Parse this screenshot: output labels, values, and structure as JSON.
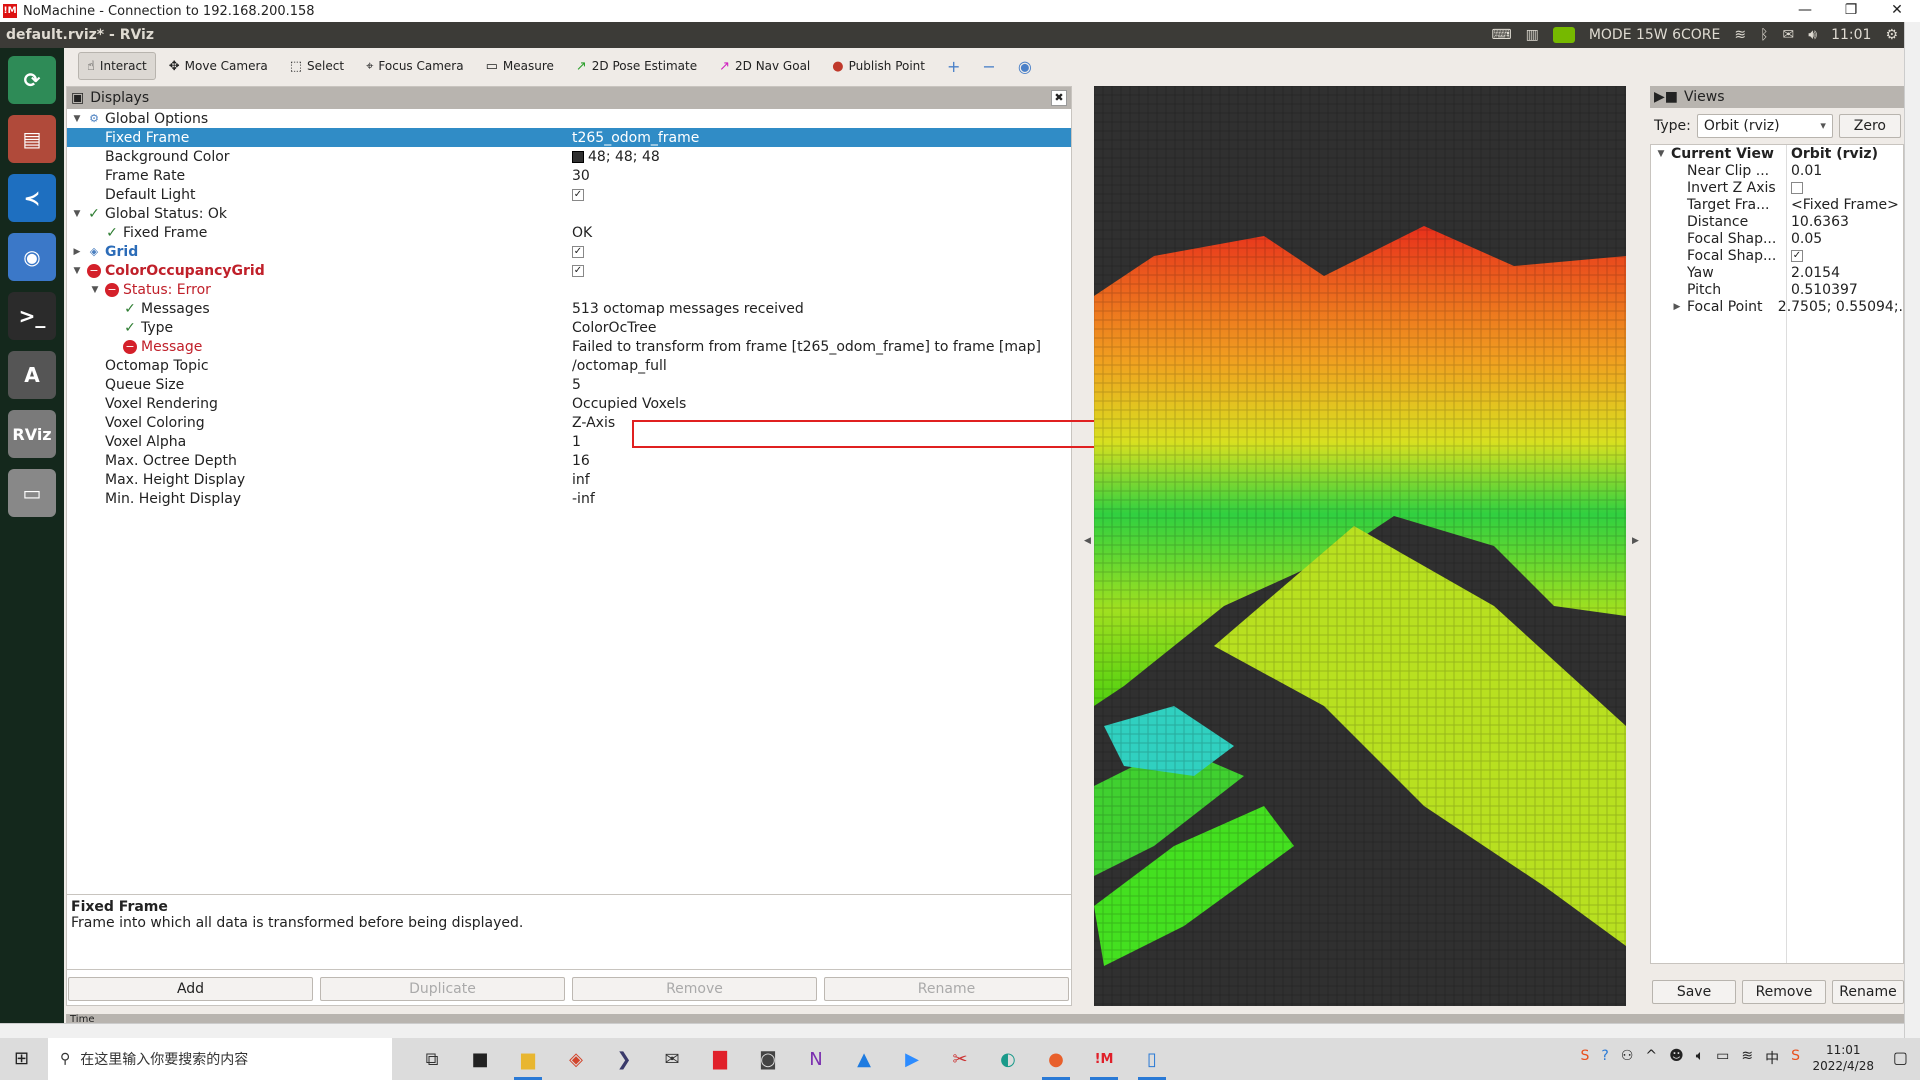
{
  "nomachine": {
    "title": "NoMachine - Connection to 192.168.200.158",
    "logo": "!M"
  },
  "window": {
    "title": "default.rviz* - RViz",
    "min": "—",
    "restore": "❐",
    "close": "✕"
  },
  "tray": {
    "power_mode": "MODE 15W 6CORE",
    "time": "11:01",
    "icons": [
      "keyboard-icon",
      "nomachine-icon",
      "nvidia-icon",
      "wifi-icon",
      "bluetooth-icon",
      "mail-icon",
      "volume-icon",
      "settings-icon"
    ]
  },
  "launcher": [
    {
      "name": "ros-launcher",
      "glyph": "⟳",
      "color": "#2e8b57"
    },
    {
      "name": "files",
      "glyph": "▤",
      "color": "#b04a3a"
    },
    {
      "name": "vscode",
      "glyph": "≺",
      "color": "#1e6fc0"
    },
    {
      "name": "chromium",
      "glyph": "◉",
      "color": "#3b78c8"
    },
    {
      "name": "terminal",
      "glyph": ">_",
      "color": "#2b2b2b"
    },
    {
      "name": "software-updater",
      "glyph": "A",
      "color": "#555"
    },
    {
      "name": "rviz",
      "glyph": "RViz",
      "color": "#7a7a7a"
    },
    {
      "name": "drive",
      "glyph": "▭",
      "color": "#888"
    }
  ],
  "toolbar": [
    {
      "label": "Interact",
      "icon": "hand-icon",
      "glyph": "☝",
      "active": true
    },
    {
      "label": "Move Camera",
      "icon": "move-camera-icon",
      "glyph": "✥"
    },
    {
      "label": "Select",
      "icon": "select-icon",
      "glyph": "⬚"
    },
    {
      "label": "Focus Camera",
      "icon": "focus-camera-icon",
      "glyph": "⌖"
    },
    {
      "label": "Measure",
      "icon": "ruler-icon",
      "glyph": "▭"
    },
    {
      "label": "2D Pose Estimate",
      "icon": "pose-estimate-arrow-icon",
      "glyph": "↗",
      "color": "#2ca02c"
    },
    {
      "label": "2D Nav Goal",
      "icon": "nav-goal-arrow-icon",
      "glyph": "↗",
      "color": "#d020c0"
    },
    {
      "label": "Publish Point",
      "icon": "map-pin-icon",
      "glyph": "●",
      "color": "#c0392b"
    }
  ],
  "toolbar_extra": {
    "add": "+",
    "remove": "−",
    "eye": "◉"
  },
  "displays": {
    "title": "Displays",
    "rows": [
      {
        "level": 0,
        "exp": "▼",
        "icon": "gear",
        "label": "Global Options",
        "value": ""
      },
      {
        "level": 1,
        "label": "Fixed Frame",
        "value": "t265_odom_frame",
        "selected": true
      },
      {
        "level": 1,
        "label": "Background Color",
        "value": "48; 48; 48",
        "swatch": "#303030"
      },
      {
        "level": 1,
        "label": "Frame Rate",
        "value": "30"
      },
      {
        "level": 1,
        "label": "Default Light",
        "value": "",
        "check": true
      },
      {
        "level": 0,
        "exp": "▼",
        "icon": "ok",
        "label": "Global Status: Ok",
        "value": ""
      },
      {
        "level": 1,
        "icon": "ok",
        "label": "Fixed Frame",
        "value": "OK"
      },
      {
        "level": 0,
        "exp": "▶",
        "icon": "grid",
        "label": "Grid",
        "value": "",
        "check": true,
        "style": "blue"
      },
      {
        "level": 0,
        "exp": "▼",
        "icon": "err",
        "label": "ColorOccupancyGrid",
        "value": "",
        "check": true,
        "style": "redb"
      },
      {
        "level": 1,
        "exp": "▼",
        "icon": "err",
        "label": "Status: Error",
        "value": "",
        "style": "red"
      },
      {
        "level": 2,
        "icon": "ok",
        "label": "Messages",
        "value": "513 octomap messages received"
      },
      {
        "level": 2,
        "icon": "ok",
        "label": "Type",
        "value": "ColorOcTree"
      },
      {
        "level": 2,
        "icon": "err",
        "label": "Message",
        "value": "Failed to transform from frame [t265_odom_frame] to frame [map]",
        "style": "red"
      },
      {
        "level": 1,
        "label": "Octomap Topic",
        "value": "/octomap_full"
      },
      {
        "level": 1,
        "label": "Queue Size",
        "value": "5"
      },
      {
        "level": 1,
        "label": "Voxel Rendering",
        "value": "Occupied Voxels"
      },
      {
        "level": 1,
        "label": "Voxel Coloring",
        "value": "Z-Axis"
      },
      {
        "level": 1,
        "label": "Voxel Alpha",
        "value": "1"
      },
      {
        "level": 1,
        "label": "Max. Octree Depth",
        "value": "16"
      },
      {
        "level": 1,
        "label": "Max. Height Display",
        "value": "inf"
      },
      {
        "level": 1,
        "label": "Min. Height Display",
        "value": "-inf"
      }
    ],
    "description": {
      "title": "Fixed Frame",
      "text": "Frame into which all data is transformed before being displayed."
    },
    "buttons": {
      "add": "Add",
      "duplicate": "Duplicate",
      "remove": "Remove",
      "rename": "Rename"
    }
  },
  "time_panel": {
    "title": "Time"
  },
  "views": {
    "title": "Views",
    "type_label": "Type:",
    "type_value": "Orbit (rviz)",
    "zero": "Zero",
    "rows": [
      {
        "exp": "▼",
        "label": "Current View",
        "value": "Orbit (rviz)",
        "bold": true
      },
      {
        "label": "Near Clip ...",
        "value": "0.01"
      },
      {
        "label": "Invert Z Axis",
        "value": "",
        "check": false
      },
      {
        "label": "Target Fra...",
        "value": "<Fixed Frame>"
      },
      {
        "label": "Distance",
        "value": "10.6363"
      },
      {
        "label": "Focal Shap...",
        "value": "0.05"
      },
      {
        "label": "Focal Shap...",
        "value": "",
        "check": true
      },
      {
        "label": "Yaw",
        "value": "2.0154"
      },
      {
        "label": "Pitch",
        "value": "0.510397"
      },
      {
        "exp": "▶",
        "label": "Focal Point",
        "value": "2.7505; 0.55094;."
      }
    ],
    "buttons": {
      "save": "Save",
      "remove": "Remove",
      "rename": "Rename"
    }
  },
  "taskbar": {
    "search_placeholder": "在这里输入你要搜索的内容",
    "apps": [
      {
        "name": "task-view",
        "glyph": "⧉",
        "color": "#333"
      },
      {
        "name": "store",
        "glyph": "■",
        "color": "#222"
      },
      {
        "name": "file-explorer",
        "glyph": "▆",
        "color": "#e8b630",
        "open": true
      },
      {
        "name": "app-red-diamond",
        "glyph": "◈",
        "color": "#d2452c"
      },
      {
        "name": "visual-studio",
        "glyph": "❯",
        "color": "#3a3a6a"
      },
      {
        "name": "mail",
        "glyph": "✉",
        "color": "#333"
      },
      {
        "name": "app-red",
        "glyph": "▇",
        "color": "#e0202a"
      },
      {
        "name": "camera",
        "glyph": "◙",
        "color": "#444"
      },
      {
        "name": "onenote",
        "glyph": "N",
        "color": "#7b2fb0"
      },
      {
        "name": "app-blue",
        "glyph": "▲",
        "color": "#1e7be0"
      },
      {
        "name": "zoom",
        "glyph": "▶",
        "color": "#2d8cff"
      },
      {
        "name": "snipping",
        "glyph": "✂",
        "color": "#c33"
      },
      {
        "name": "edge",
        "glyph": "◐",
        "color": "#1a9a8a"
      },
      {
        "name": "firefox",
        "glyph": "●",
        "color": "#e8602c",
        "open": true
      },
      {
        "name": "nomachine",
        "glyph": "!M",
        "color": "#e0202a",
        "open": true
      },
      {
        "name": "phone-app",
        "glyph": "▯",
        "color": "#2a7ad6",
        "open": true
      }
    ],
    "time": "11:01",
    "date": "2022/4/28"
  },
  "colors": {
    "accent": "#308cc6",
    "error": "#d4202a",
    "ok": "#2e7d32",
    "view_bg": "#303030"
  }
}
